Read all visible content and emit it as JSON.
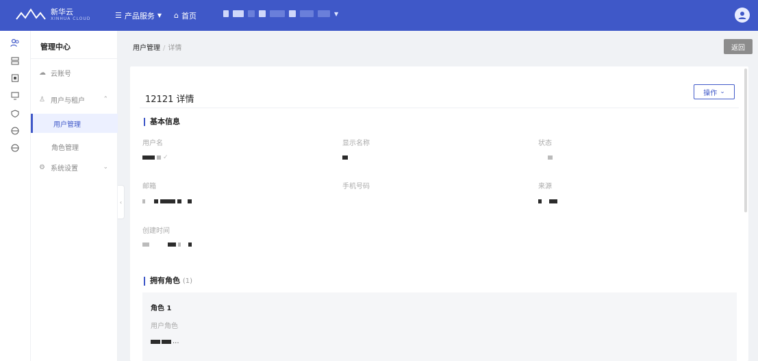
{
  "brand": {
    "name": "新华云",
    "tagline": "XINHUA CLOUD"
  },
  "topnav": {
    "products_label": "产品服务",
    "home_label": "首页"
  },
  "sidebar": {
    "title": "管理中心",
    "items": [
      {
        "label": "云账号"
      },
      {
        "label": "用户与租户"
      },
      {
        "label": "用户管理"
      },
      {
        "label": "角色管理"
      },
      {
        "label": "系统设置"
      }
    ]
  },
  "breadcrumb": {
    "main": "用户管理",
    "sub": "详情"
  },
  "header": {
    "back_label": "返回"
  },
  "detail": {
    "title": "12121 详情",
    "ops_label": "操作",
    "basic_section": "基本信息",
    "fields": {
      "username_label": "用户名",
      "display_name_label": "显示名称",
      "status_label": "状态",
      "email_label": "邮箱",
      "phone_label": "手机号码",
      "source_label": "来源",
      "created_label": "创建时间"
    },
    "roles_section": "拥有角色",
    "roles_count": "(1)",
    "role": {
      "name": "角色 1",
      "label": "用户角色"
    }
  },
  "colors": {
    "accent": "#3f58c8",
    "topbar": "#3f58c8"
  }
}
